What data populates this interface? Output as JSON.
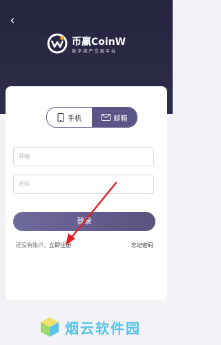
{
  "header": {
    "back_icon": "chevron-left-icon",
    "brand_name": "币赢CoinW",
    "brand_subtitle": "数字资产交易平台"
  },
  "tabs": [
    {
      "label": "手机",
      "icon": "phone-icon",
      "selected": false
    },
    {
      "label": "邮箱",
      "icon": "mail-icon",
      "selected": true
    }
  ],
  "form": {
    "email_placeholder": "邮箱",
    "password_placeholder": "密码",
    "login_label": "登录"
  },
  "footer_links": {
    "no_account_text": "还没有账户，",
    "register_label": "立即注册",
    "forgot_label": "忘记密码"
  },
  "watermark": {
    "text": "烟云软件园",
    "icon": "cube-logo-icon"
  },
  "colors": {
    "header_bg": "#252540",
    "accent": "#5b5486",
    "arrow": "#e02020",
    "watermark": "#55c4e8"
  }
}
